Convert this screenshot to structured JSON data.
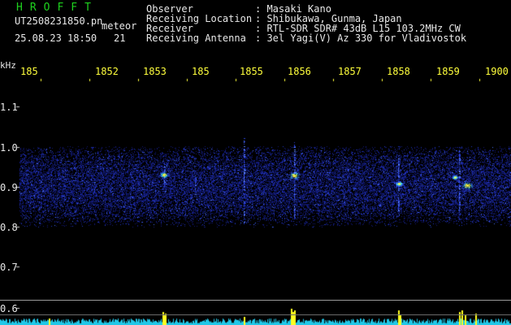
{
  "header": {
    "title": "HROFFT",
    "filename": "UT2508231850.pn",
    "mode": "meteor",
    "datetime": "25.08.23 18:50",
    "count": "21"
  },
  "info": {
    "rows": [
      {
        "label": "Observer",
        "value": ": Masaki Kano"
      },
      {
        "label": "Receiving Location",
        "value": ": Shibukawa, Gunma, Japan"
      },
      {
        "label": "Receiver",
        "value": ": RTL-SDR SDR# 43dB L15 103.2MHz CW"
      },
      {
        "label": "Receiving Antenna",
        "value": ": 3el Yagi(V) Az 330 for Vladivostok"
      }
    ]
  },
  "spectrogram": {
    "unit_label": "kHz",
    "y_ticks": [
      "1.1",
      "1.0",
      "0.9",
      "0.8",
      "0.7",
      "0.6"
    ],
    "time_ticks": [
      "185",
      "1852",
      "1853",
      "185",
      "1855",
      "1856",
      "1857",
      "1858",
      "1859",
      "1900"
    ],
    "colors": {
      "text": "#e8e8e8",
      "time": "#ffff3c",
      "title": "#1ed21e",
      "signal": "#2030c8",
      "hot": "#ffff20",
      "level": "#20c8e8"
    }
  }
}
